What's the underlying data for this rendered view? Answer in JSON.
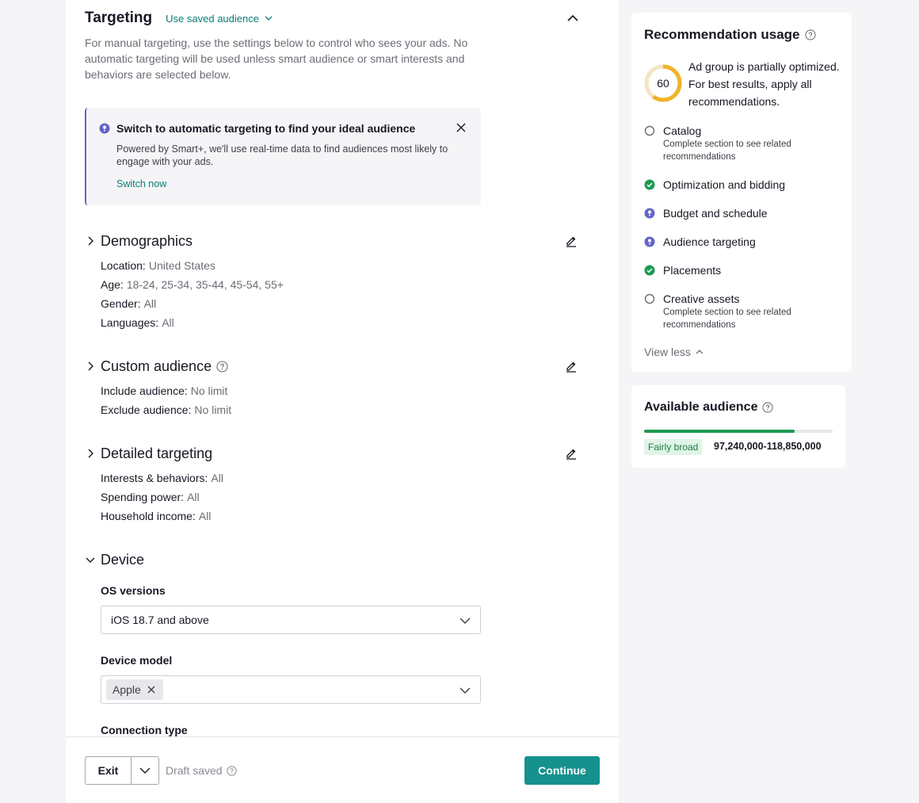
{
  "targeting": {
    "title": "Targeting",
    "saved_audience_label": "Use saved audience",
    "intro": "For manual targeting, use the settings below to control who sees your ads. No automatic targeting will be used unless smart audience or smart interests and behaviors are selected below."
  },
  "smart_banner": {
    "title": "Switch to automatic targeting to find your ideal audience",
    "description": "Powered by Smart+, we'll use real-time data to find audiences most likely to engage with your ads.",
    "link": "Switch now"
  },
  "demographics": {
    "title": "Demographics",
    "rows": [
      {
        "label": "Location:",
        "value": "United States"
      },
      {
        "label": "Age:",
        "value": "18-24, 25-34, 35-44, 45-54, 55+"
      },
      {
        "label": "Gender:",
        "value": "All"
      },
      {
        "label": "Languages:",
        "value": "All"
      }
    ]
  },
  "custom_audience": {
    "title": "Custom audience",
    "rows": [
      {
        "label": "Include audience:",
        "value": "No limit"
      },
      {
        "label": "Exclude audience:",
        "value": "No limit"
      }
    ]
  },
  "detailed_targeting": {
    "title": "Detailed targeting",
    "rows": [
      {
        "label": "Interests & behaviors:",
        "value": "All"
      },
      {
        "label": "Spending power:",
        "value": "All"
      },
      {
        "label": "Household income:",
        "value": "All"
      }
    ]
  },
  "device": {
    "title": "Device",
    "os_label": "OS versions",
    "os_value": "iOS 18.7 and above",
    "model_label": "Device model",
    "model_tag": "Apple",
    "connection_label": "Connection type"
  },
  "footer": {
    "exit_label": "Exit",
    "draft_label": "Draft saved",
    "continue_label": "Continue"
  },
  "recommendations": {
    "title": "Recommendation usage",
    "score": "60",
    "score_fraction": 0.6,
    "message": "Ad group is partially optimized. For best results, apply all recommendations.",
    "items": [
      {
        "name": "Catalog",
        "sub": "Complete section to see related recommendations",
        "status": "empty"
      },
      {
        "name": "Optimization and bidding",
        "sub": "",
        "status": "done"
      },
      {
        "name": "Budget and schedule",
        "sub": "",
        "status": "tip"
      },
      {
        "name": "Audience targeting",
        "sub": "",
        "status": "tip"
      },
      {
        "name": "Placements",
        "sub": "",
        "status": "done"
      },
      {
        "name": "Creative assets",
        "sub": "Complete section to see related recommendations",
        "status": "empty"
      }
    ],
    "view_less": "View less"
  },
  "audience": {
    "title": "Available audience",
    "breadth_fraction": 0.8,
    "badge": "Fairly broad",
    "range": "97,240,000-118,850,000"
  },
  "colors": {
    "accent": "#15918e",
    "link": "#0b7b75",
    "tip": "#6465c8",
    "success": "#1b9a52",
    "score_ring": "#f0b429"
  }
}
